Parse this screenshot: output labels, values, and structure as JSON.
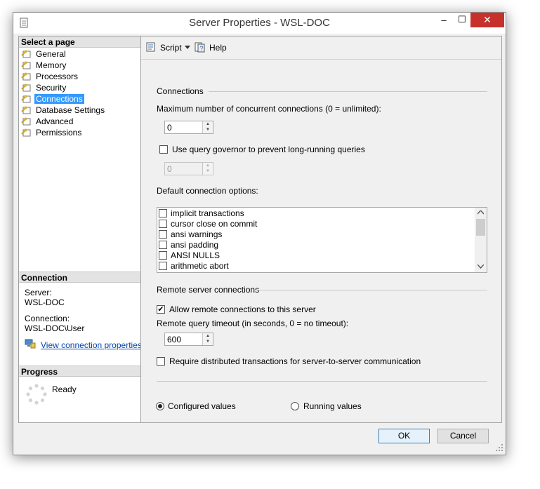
{
  "window": {
    "title": "Server Properties - WSL-DOC",
    "minimize_glyph": "–",
    "maximize_glyph": "☐",
    "close_glyph": "✕"
  },
  "select_page": {
    "header": "Select a page",
    "items": [
      {
        "label": "General",
        "icon": "wrench-page-icon",
        "selected": false
      },
      {
        "label": "Memory",
        "icon": "wrench-page-icon",
        "selected": false
      },
      {
        "label": "Processors",
        "icon": "wrench-page-icon",
        "selected": false
      },
      {
        "label": "Security",
        "icon": "wrench-page-icon",
        "selected": false
      },
      {
        "label": "Connections",
        "icon": "wrench-page-icon",
        "selected": true
      },
      {
        "label": "Database Settings",
        "icon": "wrench-page-icon",
        "selected": false
      },
      {
        "label": "Advanced",
        "icon": "wrench-page-icon",
        "selected": false
      },
      {
        "label": "Permissions",
        "icon": "wrench-page-icon",
        "selected": false
      }
    ]
  },
  "connection": {
    "header": "Connection",
    "server_label": "Server:",
    "server_value": "WSL-DOC",
    "connection_label": "Connection:",
    "connection_value": "WSL-DOC\\User",
    "view_link": "View connection properties"
  },
  "progress": {
    "header": "Progress",
    "status": "Ready"
  },
  "toolbar": {
    "script_label": "Script",
    "help_label": "Help"
  },
  "connections": {
    "group_title": "Connections",
    "max_conn_label": "Maximum number of concurrent connections (0 = unlimited):",
    "max_conn_value": "0",
    "query_governor_label": "Use query governor to prevent long-running queries",
    "query_governor_checked": false,
    "query_governor_value": "0",
    "default_options_label": "Default connection options:",
    "default_options": [
      {
        "label": "implicit transactions",
        "checked": false
      },
      {
        "label": "cursor close on commit",
        "checked": false
      },
      {
        "label": "ansi warnings",
        "checked": false
      },
      {
        "label": "ansi padding",
        "checked": false
      },
      {
        "label": "ANSI NULLS",
        "checked": false
      },
      {
        "label": "arithmetic abort",
        "checked": false
      }
    ]
  },
  "remote": {
    "group_title": "Remote server connections",
    "allow_label": "Allow remote connections to this server",
    "allow_checked": true,
    "timeout_label": "Remote query timeout (in seconds, 0 = no timeout):",
    "timeout_value": "600",
    "distributed_label": "Require distributed transactions for server-to-server communication",
    "distributed_checked": false
  },
  "values_mode": {
    "configured_label": "Configured values",
    "running_label": "Running values",
    "selected": "configured"
  },
  "buttons": {
    "ok": "OK",
    "cancel": "Cancel"
  },
  "colors": {
    "selection": "#3399ff",
    "close_button": "#c7312c",
    "link": "#0645ad"
  }
}
